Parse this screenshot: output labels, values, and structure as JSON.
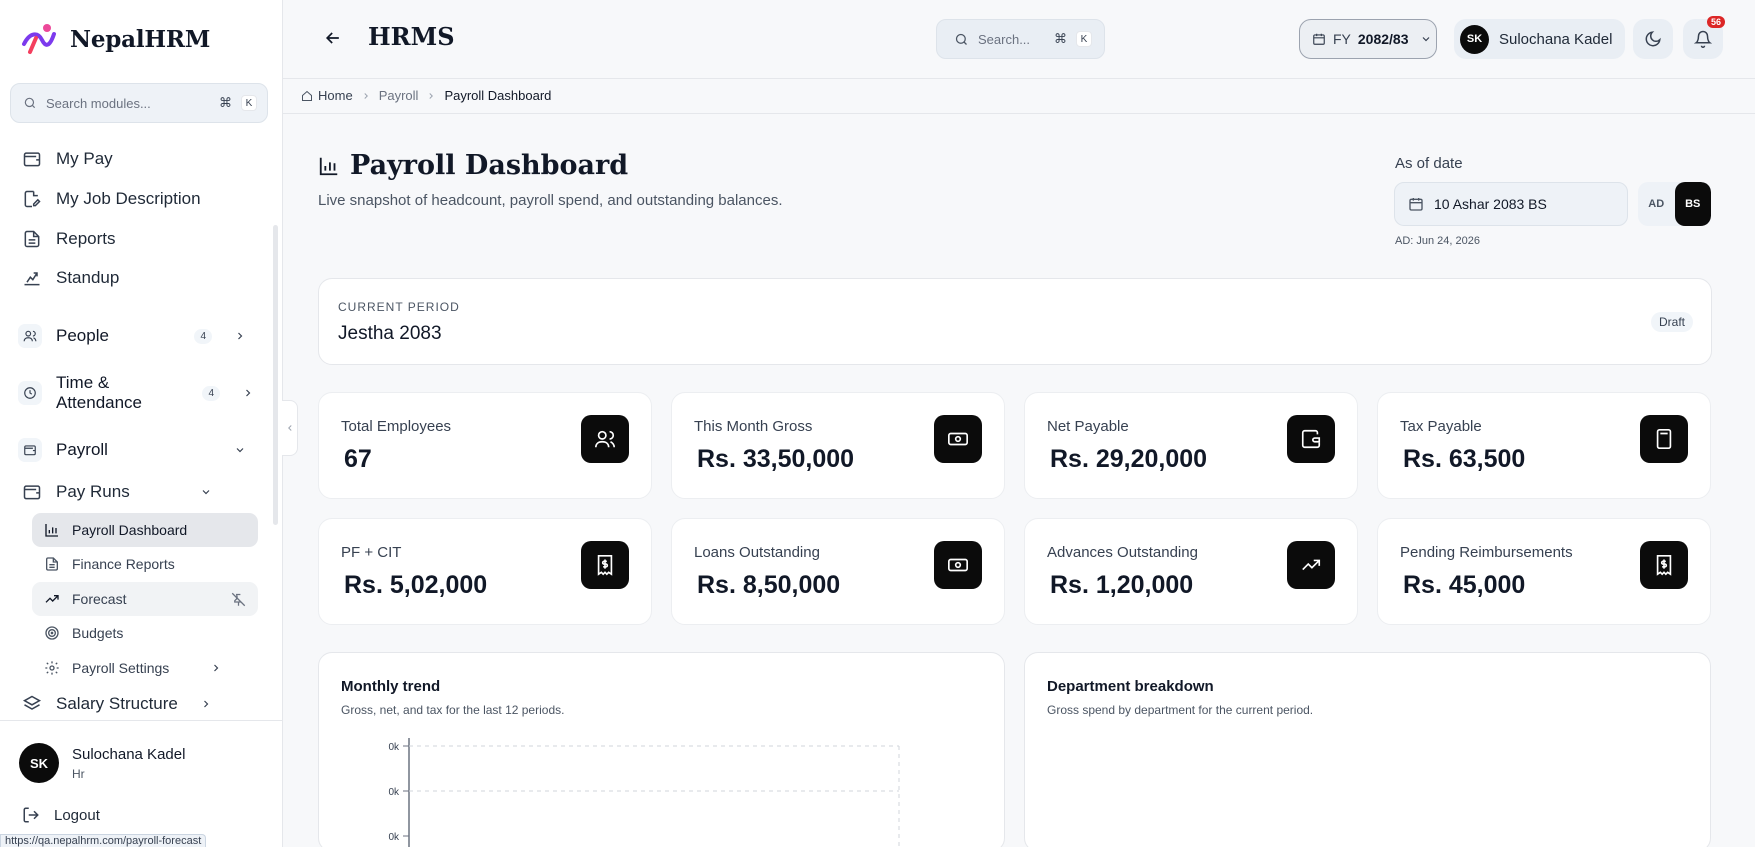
{
  "brand": {
    "name": "NepalHRM"
  },
  "sidebar": {
    "search_placeholder": "Search modules...",
    "kbd_cmd": "⌘",
    "kbd_k": "K",
    "items": [
      {
        "label": "My Pay"
      },
      {
        "label": "My Job Description"
      },
      {
        "label": "Reports"
      },
      {
        "label": "Standup"
      }
    ],
    "groups": [
      {
        "label": "People",
        "count": "4"
      },
      {
        "label": "Time & Attendance",
        "count": "4"
      },
      {
        "label": "Payroll"
      }
    ],
    "pay_runs": {
      "label": "Pay Runs"
    },
    "sub_items": [
      {
        "label": "Payroll Dashboard"
      },
      {
        "label": "Finance Reports"
      },
      {
        "label": "Forecast"
      },
      {
        "label": "Budgets"
      },
      {
        "label": "Payroll Settings"
      }
    ],
    "salary_structure": {
      "label": "Salary Structure"
    },
    "footer": {
      "initials": "SK",
      "name": "Sulochana Kadel",
      "role": "Hr",
      "logout": "Logout"
    },
    "status_url": "https://qa.nepalhrm.com/payroll-forecast"
  },
  "topbar": {
    "title": "HRMS",
    "search_placeholder": "Search...",
    "kbd_cmd": "⌘",
    "kbd_k": "K",
    "fy_prefix": "FY",
    "fy_value": "2082/83",
    "user_initials": "SK",
    "user_name": "Sulochana Kadel",
    "notification_count": "56"
  },
  "breadcrumb": {
    "home": "Home",
    "section": "Payroll",
    "current": "Payroll Dashboard"
  },
  "page": {
    "title": "Payroll Dashboard",
    "subtitle": "Live snapshot of headcount, payroll spend, and outstanding balances.",
    "as_of_label": "As of date",
    "date_value": "10 Ashar 2083 BS",
    "toggle_ad": "AD",
    "toggle_bs": "BS",
    "ad_note": "AD: Jun 24, 2026"
  },
  "period": {
    "label": "CURRENT PERIOD",
    "value": "Jestha 2083",
    "status": "Draft"
  },
  "stats": [
    {
      "title": "Total Employees",
      "value": "67",
      "icon": "users-icon"
    },
    {
      "title": "This Month Gross",
      "value": "Rs. 33,50,000",
      "icon": "banknote-icon"
    },
    {
      "title": "Net Payable",
      "value": "Rs. 29,20,000",
      "icon": "wallet-icon"
    },
    {
      "title": "Tax Payable",
      "value": "Rs. 63,500",
      "icon": "calculator-icon"
    },
    {
      "title": "PF + CIT",
      "value": "Rs. 5,02,000",
      "icon": "receipt-icon"
    },
    {
      "title": "Loans Outstanding",
      "value": "Rs. 8,50,000",
      "icon": "banknote-icon"
    },
    {
      "title": "Advances Outstanding",
      "value": "Rs. 1,20,000",
      "icon": "trending-up-icon"
    },
    {
      "title": "Pending Reimbursements",
      "value": "Rs. 45,000",
      "icon": "receipt-icon"
    }
  ],
  "trend": {
    "title": "Monthly trend",
    "subtitle": "Gross, net, and tax for the last 12 periods.",
    "y_ticks": [
      "0k",
      "0k",
      "0k"
    ]
  },
  "department": {
    "title": "Department breakdown",
    "subtitle": "Gross spend by department for the current period."
  }
}
